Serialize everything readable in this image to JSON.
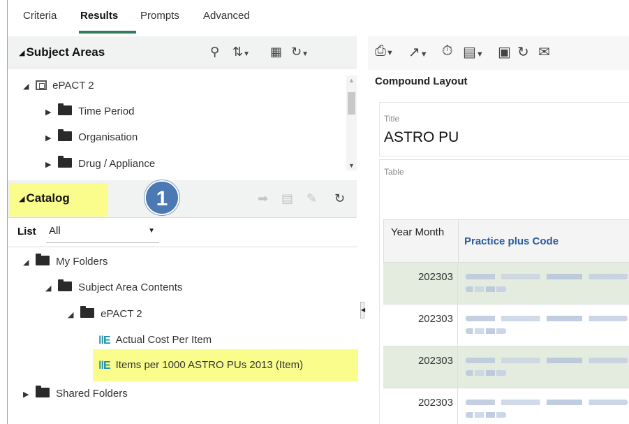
{
  "tabs": [
    "Criteria",
    "Results",
    "Prompts",
    "Advanced"
  ],
  "subject_areas": {
    "title": "Subject Areas",
    "root": "ePACT 2",
    "items": [
      "Time Period",
      "Organisation",
      "Drug / Appliance"
    ]
  },
  "catalog": {
    "title": "Catalog",
    "callout_number": "1",
    "list_label": "List",
    "list_value": "All",
    "tree": {
      "my_folders": "My Folders",
      "subject_area_contents": "Subject Area Contents",
      "epact": "ePACT 2",
      "analyses": [
        "Actual Cost Per Item",
        "Items per 1000 ASTRO PUs 2013 (Item)"
      ],
      "shared_folders": "Shared Folders"
    }
  },
  "right": {
    "compound_layout": "Compound Layout",
    "title_label": "Title",
    "title_value": "ASTRO PU",
    "table_label": "Table",
    "columns": [
      "Year Month",
      "Practice plus Code"
    ],
    "rows": [
      "202303",
      "202303",
      "202303",
      "202303"
    ]
  },
  "colors": {
    "highlight": "#fafc8c",
    "callout": "#4a79b3",
    "active_tab": "#2e7d5b",
    "row_alt": "#e3ecdf",
    "link": "#2a5b9a"
  }
}
